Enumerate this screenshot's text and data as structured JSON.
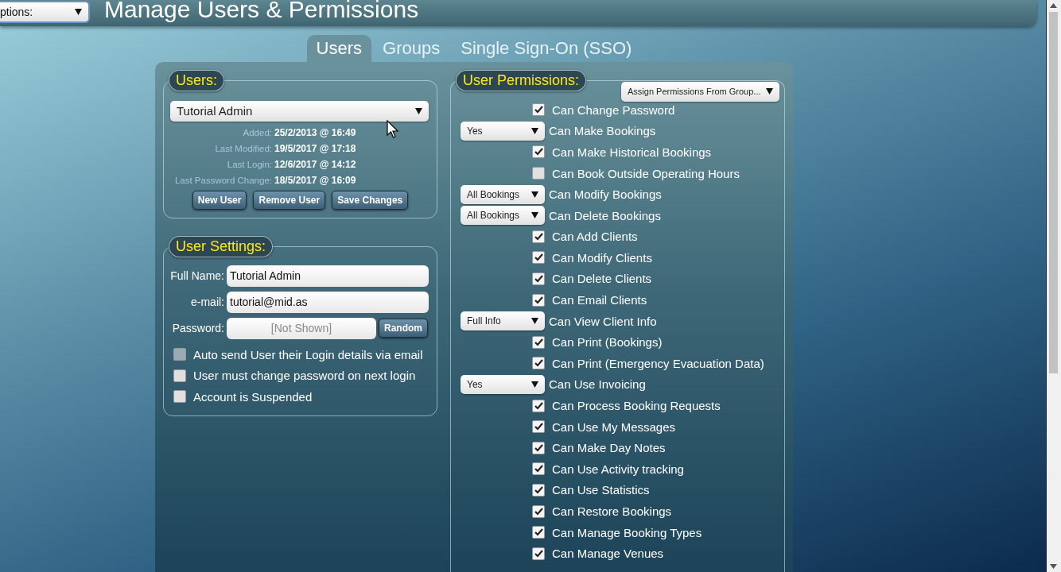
{
  "header": {
    "options_select": "ptions:",
    "title": "Manage Users & Permissions"
  },
  "tabs": [
    {
      "label": "Users",
      "selected": true
    },
    {
      "label": "Groups",
      "selected": false
    },
    {
      "label": "Single Sign-On (SSO)",
      "selected": false
    }
  ],
  "users": {
    "legend": "Users:",
    "selected_user": "Tutorial Admin",
    "info": [
      {
        "label": "Added:",
        "value": "25/2/2013 @ 16:49"
      },
      {
        "label": "Last Modified:",
        "value": "19/5/2017 @ 17:18"
      },
      {
        "label": "Last Login:",
        "value": "12/6/2017 @ 14:12"
      },
      {
        "label": "Last Password Change:",
        "value": "18/5/2017 @ 16:09"
      }
    ],
    "buttons": [
      "New User",
      "Remove User",
      "Save Changes"
    ]
  },
  "settings": {
    "legend": "User Settings:",
    "full_name": {
      "label": "Full Name:",
      "value": "Tutorial Admin"
    },
    "email": {
      "label": "e-mail:",
      "value": "tutorial@mid.as"
    },
    "password": {
      "label": "Password:",
      "placeholder": "[Not Shown]",
      "button": "Random"
    },
    "options": [
      {
        "label": "Auto send User their Login details via email",
        "checked": false,
        "disabled": true
      },
      {
        "label": "User must change password on next login",
        "checked": false,
        "disabled": false
      },
      {
        "label": "Account is Suspended",
        "checked": false,
        "disabled": false
      }
    ]
  },
  "permissions": {
    "legend": "User Permissions:",
    "assign_select": "Assign Permissions From Group...",
    "items": [
      {
        "kind": "checkbox",
        "label": "Can Change Password",
        "checked": true
      },
      {
        "kind": "select",
        "label": "Can Make Bookings",
        "value": "Yes"
      },
      {
        "kind": "checkbox",
        "label": "Can Make Historical Bookings",
        "checked": true
      },
      {
        "kind": "checkbox",
        "label": "Can Book Outside Operating Hours",
        "checked": false
      },
      {
        "kind": "select",
        "label": "Can Modify Bookings",
        "value": "All Bookings"
      },
      {
        "kind": "select",
        "label": "Can Delete Bookings",
        "value": "All Bookings"
      },
      {
        "kind": "checkbox",
        "label": "Can Add Clients",
        "checked": true
      },
      {
        "kind": "checkbox",
        "label": "Can Modify Clients",
        "checked": true
      },
      {
        "kind": "checkbox",
        "label": "Can Delete Clients",
        "checked": true
      },
      {
        "kind": "checkbox",
        "label": "Can Email Clients",
        "checked": true
      },
      {
        "kind": "select",
        "label": "Can View Client Info",
        "value": "Full Info"
      },
      {
        "kind": "checkbox",
        "label": "Can Print (Bookings)",
        "checked": true
      },
      {
        "kind": "checkbox",
        "label": "Can Print (Emergency Evacuation Data)",
        "checked": true
      },
      {
        "kind": "select",
        "label": "Can Use Invoicing",
        "value": "Yes"
      },
      {
        "kind": "checkbox",
        "label": "Can Process Booking Requests",
        "checked": true
      },
      {
        "kind": "checkbox",
        "label": "Can Use My Messages",
        "checked": true
      },
      {
        "kind": "checkbox",
        "label": "Can Make Day Notes",
        "checked": true
      },
      {
        "kind": "checkbox",
        "label": "Can Use Activity tracking",
        "checked": true
      },
      {
        "kind": "checkbox",
        "label": "Can Use Statistics",
        "checked": true
      },
      {
        "kind": "checkbox",
        "label": "Can Restore Bookings",
        "checked": true
      },
      {
        "kind": "checkbox",
        "label": "Can Manage Booking Types",
        "checked": true
      },
      {
        "kind": "checkbox",
        "label": "Can Manage Venues",
        "checked": true
      }
    ]
  }
}
